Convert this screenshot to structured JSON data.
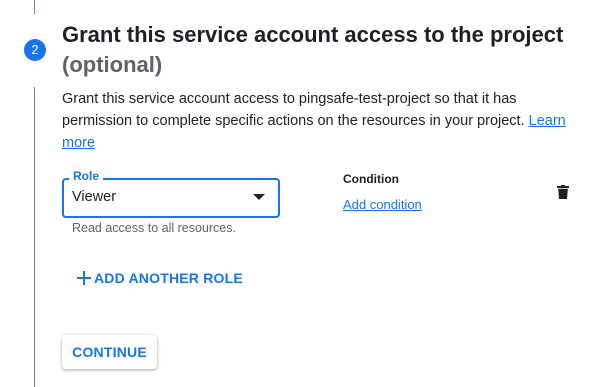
{
  "step": {
    "number": "2",
    "title": "Grant this service account access to the project",
    "optional": "(optional)",
    "description": "Grant this service account access to pingsafe-test-project so that it has permission to complete specific actions on the resources in your project.",
    "learn_more": "Learn more"
  },
  "role": {
    "label": "Role",
    "value": "Viewer",
    "hint": "Read access to all resources."
  },
  "condition": {
    "label": "Condition",
    "add_link": "Add condition"
  },
  "actions": {
    "add_another_role": "ADD ANOTHER ROLE",
    "continue": "CONTINUE"
  },
  "icons": {
    "delete": "trash-icon",
    "dropdown": "dropdown-arrow-icon",
    "add": "plus-icon"
  },
  "colors": {
    "accent": "#1a73e8",
    "text": "#202124",
    "muted": "#5f6368"
  }
}
